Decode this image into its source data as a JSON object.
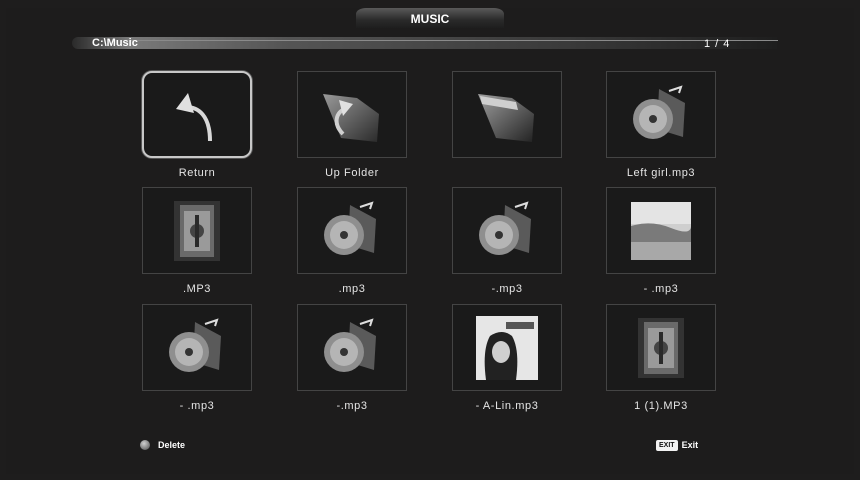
{
  "header": {
    "title": "MUSIC"
  },
  "path_bar": {
    "path": "C:\\Music",
    "page": "1 / 4"
  },
  "grid": {
    "items": [
      {
        "label": "Return",
        "icon": "return-arrow-icon"
      },
      {
        "label": "Up Folder",
        "icon": "up-folder-icon"
      },
      {
        "label": "",
        "icon": "folder-icon"
      },
      {
        "label": "Left girl.mp3",
        "icon": "music-disc-icon"
      },
      {
        "label": ".MP3",
        "icon": "album-art-thumbnail"
      },
      {
        "label": ".mp3",
        "icon": "music-disc-icon"
      },
      {
        "label": "-.mp3",
        "icon": "music-disc-icon"
      },
      {
        "label": "- .mp3",
        "icon": "album-art-thumbnail"
      },
      {
        "label": "- .mp3",
        "icon": "music-disc-icon"
      },
      {
        "label": "-.mp3",
        "icon": "music-disc-icon"
      },
      {
        "label": "- A-Lin.mp3",
        "icon": "album-art-thumbnail"
      },
      {
        "label": "1 (1).MP3",
        "icon": "album-art-thumbnail"
      }
    ]
  },
  "footer": {
    "delete_label": "Delete",
    "exit_key": "EXIT",
    "exit_label": "Exit"
  }
}
